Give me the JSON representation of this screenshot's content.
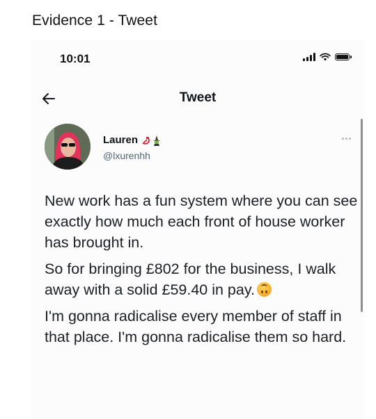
{
  "caption": "Evidence 1 - Tweet",
  "status_bar": {
    "time": "10:01",
    "icons": [
      "signal-icon",
      "wifi-icon",
      "battery-icon"
    ]
  },
  "nav": {
    "back_icon": "back-arrow-icon",
    "title": "Tweet"
  },
  "author": {
    "display_name": "Lauren",
    "name_emojis": [
      "hammer-and-sickle",
      "witch"
    ],
    "handle": "@lxurenhh"
  },
  "tweet": {
    "paragraphs": [
      "New work has a fun system where you can see exactly how much each front of house worker has brought in.",
      "So for bringing £802 for the business, I walk away with a solid £59.40 in pay.",
      "I'm gonna radicalise every member of staff in that place. I'm gonna radicalise them so hard."
    ],
    "emoji_after_paragraph_2": "upside-down-face"
  },
  "colors": {
    "text": "#0f1419",
    "secondary": "#536471",
    "background": "#fcfcfc"
  }
}
